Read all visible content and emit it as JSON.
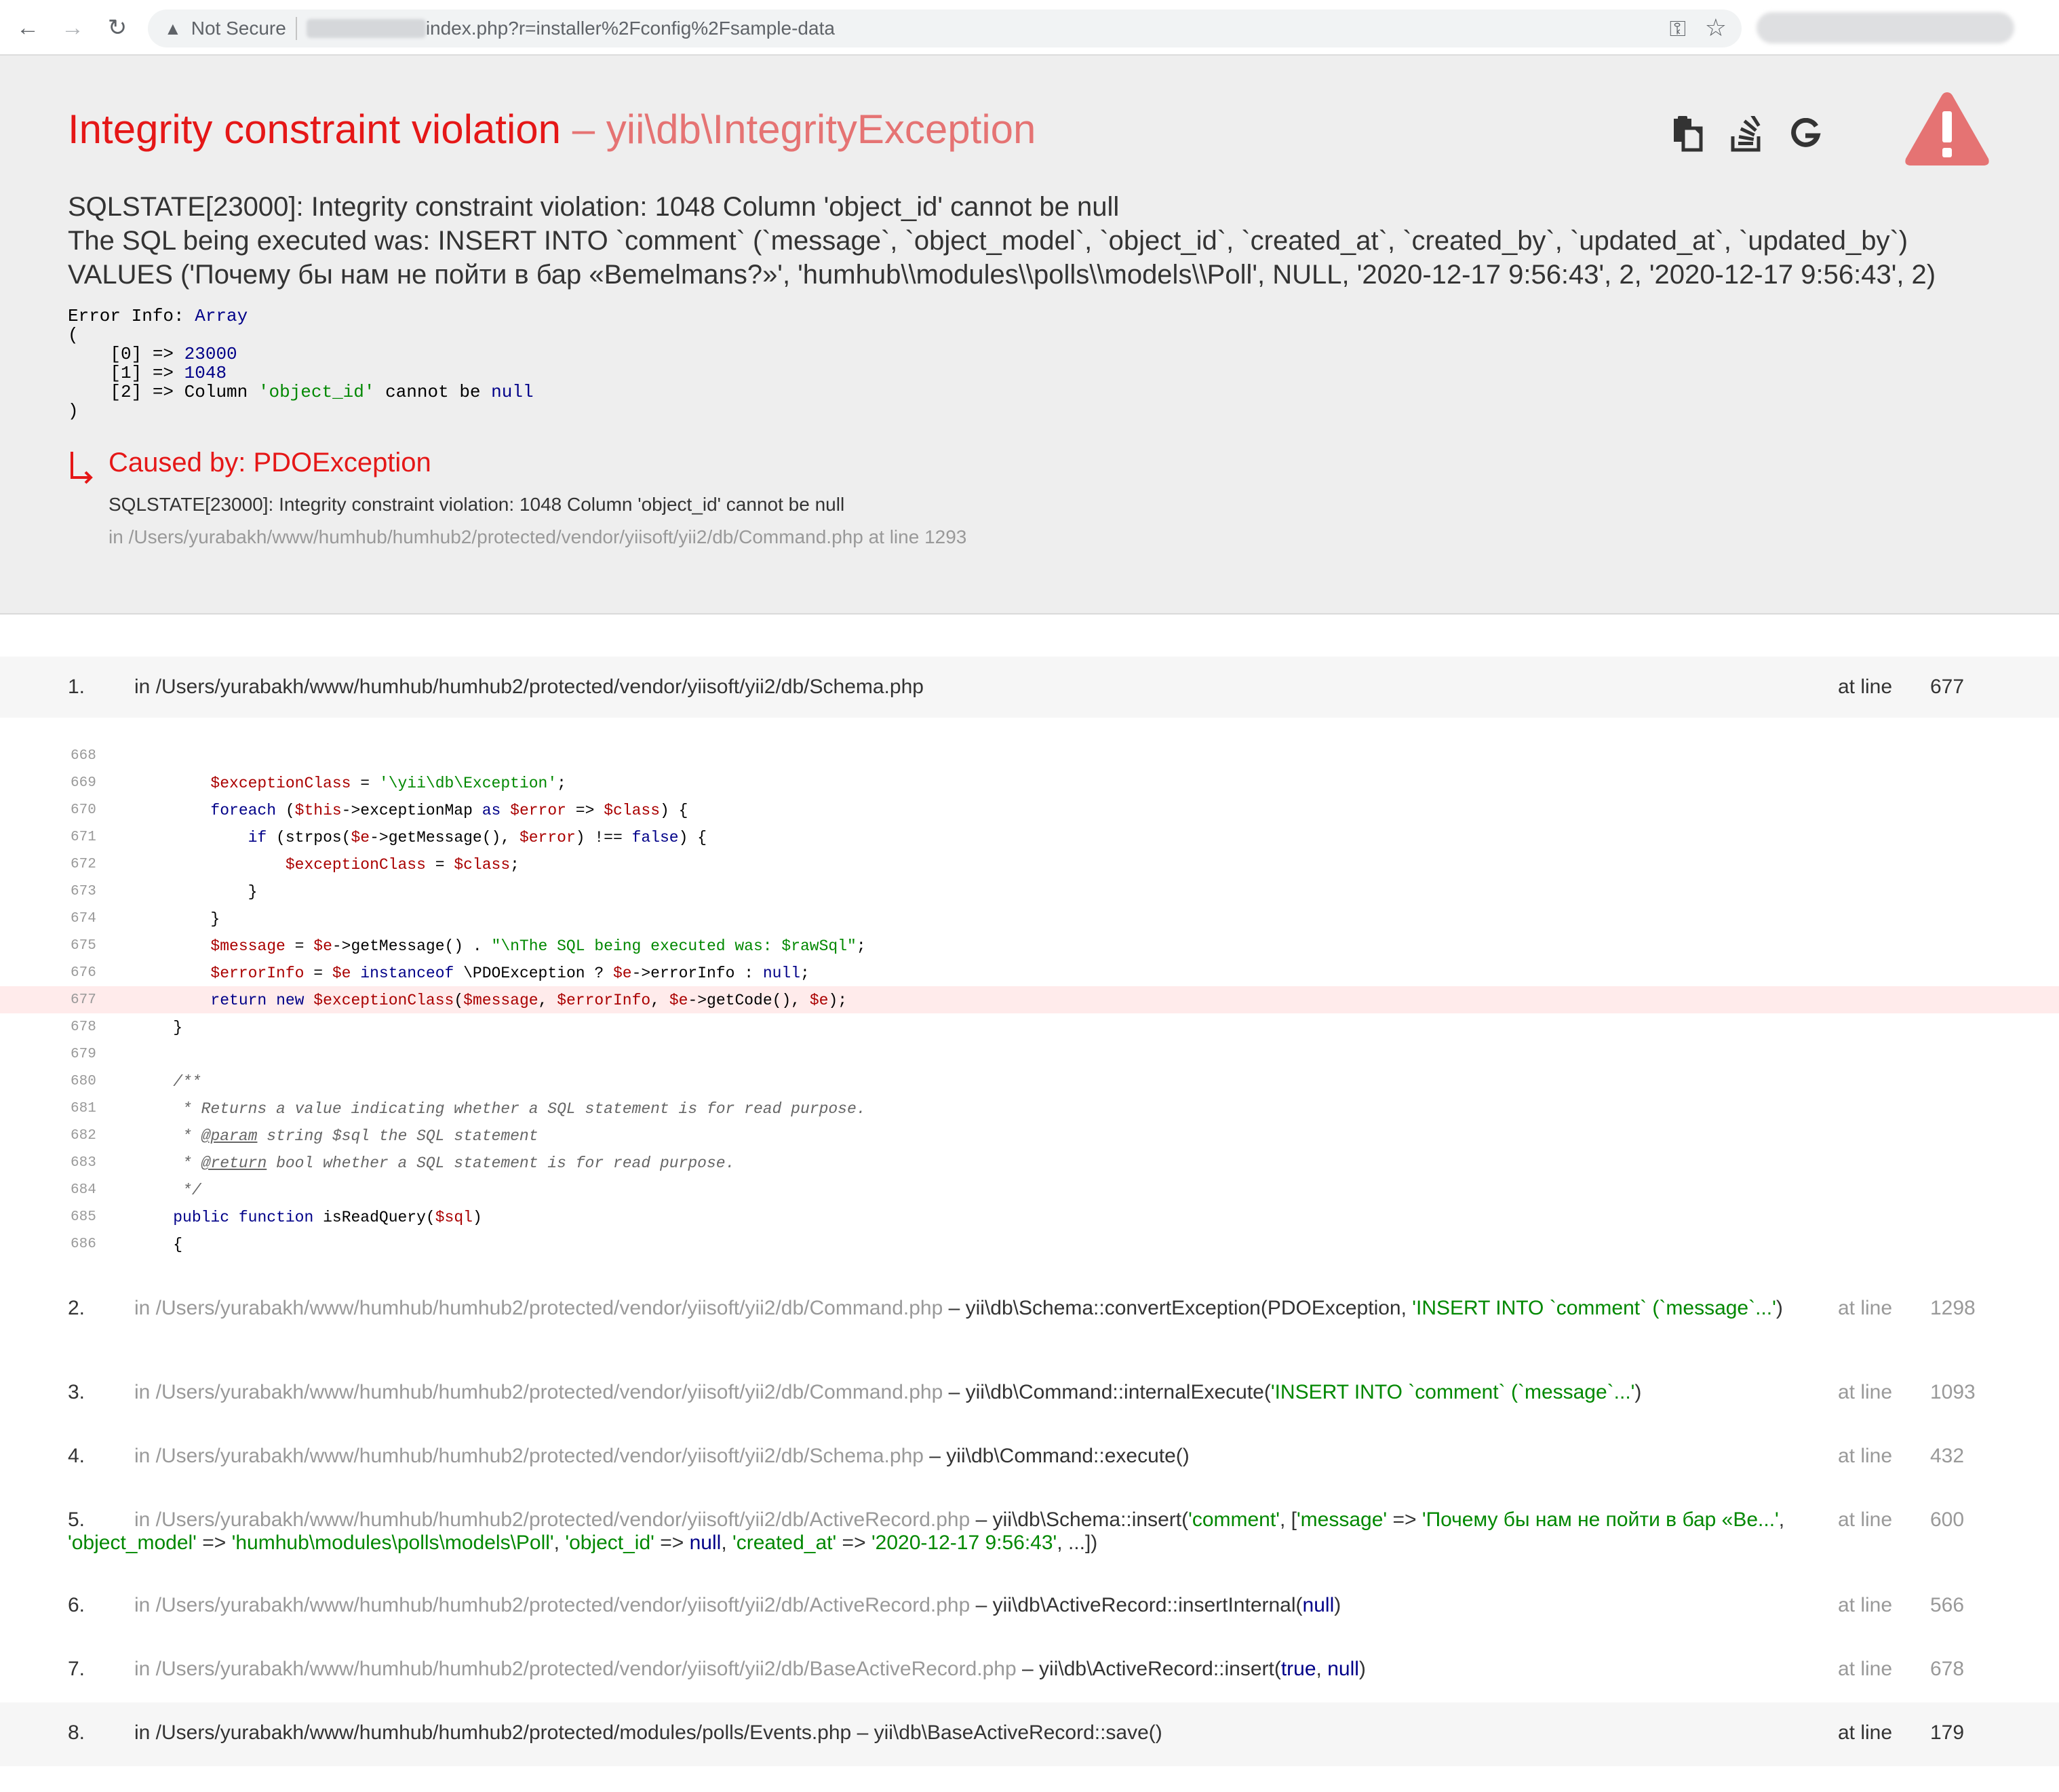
{
  "browser": {
    "security_label": "Not Secure",
    "url_visible": "index.php?r=installer%2Fconfig%2Fsample-data"
  },
  "header": {
    "title_main": "Integrity constraint violation",
    "title_sub": " – yii\\db\\IntegrityException",
    "message_line1": "SQLSTATE[23000]: Integrity constraint violation: 1048 Column 'object_id' cannot be null",
    "message_line2": "The SQL being executed was: INSERT INTO `comment` (`message`, `object_model`, `object_id`, `created_at`, `created_by`, `updated_at`, `updated_by`)",
    "message_line3": "VALUES ('Почему бы нам не пойти в бар «Bemelmans?»', 'humhub\\\\modules\\\\polls\\\\models\\\\Poll', NULL, '2020-12-17 9:56:43', 2, '2020-12-17 9:56:43', 2)",
    "error_info": {
      "label": "Error Info: ",
      "type": "Array",
      "open": "(",
      "rows": [
        {
          "key": "    [0] => ",
          "value": "23000"
        },
        {
          "key": "    [1] => ",
          "value": "1048"
        },
        {
          "key": "    [2] => ",
          "value_pre": "Column ",
          "value_str": "'object_id'",
          "value_mid": " cannot be ",
          "value_kw": "null"
        }
      ],
      "close": ")"
    },
    "caused_by": "Caused by: PDOException",
    "caused_message": "SQLSTATE[23000]: Integrity constraint violation: 1048 Column 'object_id' cannot be null",
    "caused_file": "in /Users/yurabakh/www/humhub/humhub2/protected/vendor/yiisoft/yii2/db/Command.php at line 1293"
  },
  "stack": {
    "at_line_label": "at line",
    "frame1": {
      "num": "1.",
      "file": "in /Users/yurabakh/www/humhub/humhub2/protected/vendor/yiisoft/yii2/db/Schema.php",
      "line": "677"
    },
    "code": [
      {
        "n": "668"
      },
      {
        "n": "669"
      },
      {
        "n": "670"
      },
      {
        "n": "671"
      },
      {
        "n": "672"
      },
      {
        "n": "673"
      },
      {
        "n": "674"
      },
      {
        "n": "675"
      },
      {
        "n": "676"
      },
      {
        "n": "677"
      },
      {
        "n": "678"
      },
      {
        "n": "679"
      },
      {
        "n": "680"
      },
      {
        "n": "681"
      },
      {
        "n": "682"
      },
      {
        "n": "683"
      },
      {
        "n": "684"
      },
      {
        "n": "685"
      },
      {
        "n": "686"
      }
    ],
    "code_text": {
      "l669_var": "$exceptionClass",
      "l669_op": " = ",
      "l669_str": "'\\yii\\db\\Exception'",
      "l669_end": ";",
      "l670_kw": "foreach",
      "l670_a": " (",
      "l670_v1": "$this",
      "l670_b": "->exceptionMap ",
      "l670_kw2": "as",
      "l670_c": " ",
      "l670_v2": "$error",
      "l670_d": " => ",
      "l670_v3": "$class",
      "l670_e": ") {",
      "l671_kw": "if",
      "l671_a": " (strpos(",
      "l671_v1": "$e",
      "l671_b": "->getMessage(), ",
      "l671_v2": "$error",
      "l671_c": ") !== ",
      "l671_kw2": "false",
      "l671_d": ") {",
      "l672_v1": "$exceptionClass",
      "l672_a": " = ",
      "l672_v2": "$class",
      "l672_b": ";",
      "l673": "}",
      "l674": "}",
      "l675_v1": "$message",
      "l675_a": " = ",
      "l675_v2": "$e",
      "l675_b": "->getMessage() . ",
      "l675_str": "\"\\nThe SQL being executed was: $rawSql\"",
      "l675_c": ";",
      "l676_v1": "$errorInfo",
      "l676_a": " = ",
      "l676_v2": "$e",
      "l676_b": " ",
      "l676_kw": "instanceof",
      "l676_c": " \\PDOException ? ",
      "l676_v3": "$e",
      "l676_d": "->errorInfo : ",
      "l676_kw2": "null",
      "l676_e": ";",
      "l677_kw": "return",
      "l677_a": " ",
      "l677_kw2": "new",
      "l677_b": " ",
      "l677_v1": "$exceptionClass",
      "l677_c": "(",
      "l677_v2": "$message",
      "l677_d": ", ",
      "l677_v3": "$errorInfo",
      "l677_e": ", ",
      "l677_v4": "$e",
      "l677_f": "->getCode(), ",
      "l677_v5": "$e",
      "l677_g": ");",
      "l678": "}",
      "l680": "/**",
      "l681": " * Returns a value indicating whether a SQL statement is for read purpose.",
      "l682_a": " * ",
      "l682_tag": "@param",
      "l682_b": " string $sql the SQL statement",
      "l683_a": " * ",
      "l683_tag": "@return",
      "l683_b": " bool whether a SQL statement is for read purpose.",
      "l684": " */",
      "l685_kw": "public",
      "l685_a": " ",
      "l685_kw2": "function",
      "l685_b": " isReadQuery(",
      "l685_v": "$sql",
      "l685_c": ")",
      "l686": "{"
    },
    "frames": [
      {
        "num": "2.",
        "file": "in /Users/yurabakh/www/humhub/humhub2/protected/vendor/yiisoft/yii2/db/Command.php",
        "call_a": " – yii\\db\\Schema::convertException(PDOException, ",
        "call_str": "'INSERT INTO `comment` (`message`...'",
        "call_b": ")",
        "line": "1298"
      },
      {
        "num": "3.",
        "file": "in /Users/yurabakh/www/humhub/humhub2/protected/vendor/yiisoft/yii2/db/Command.php",
        "call_a": " – yii\\db\\Command::internalExecute(",
        "call_str": "'INSERT INTO `comment` (`message`...'",
        "call_b": ")",
        "line": "1093"
      },
      {
        "num": "4.",
        "file": "in /Users/yurabakh/www/humhub/humhub2/protected/vendor/yiisoft/yii2/db/Schema.php",
        "call_a": " – yii\\db\\Command::execute()",
        "line": "432"
      },
      {
        "num": "5.",
        "file": "in /Users/yurabakh/www/humhub/humhub2/protected/vendor/yiisoft/yii2/db/ActiveRecord.php",
        "call_a": " – yii\\db\\Schema::insert(",
        "call_s1": "'comment'",
        "call_b": ", [",
        "call_s2": "'message'",
        "call_c": " => ",
        "call_s3": "'Почему бы нам не пойти в бар «Be...'",
        "call_d": ", ",
        "call_s4": "'object_model'",
        "call_e": " => ",
        "call_s5": "'humhub\\modules\\polls\\models\\Poll'",
        "call_f": ", ",
        "call_s6": "'object_id'",
        "call_g": " => ",
        "call_k1": "null",
        "call_h": ", ",
        "call_s7": "'created_at'",
        "call_i": " => ",
        "call_s8": "'2020-12-17 9:56:43'",
        "call_j": ", ...])",
        "line": "600"
      },
      {
        "num": "6.",
        "file": "in /Users/yurabakh/www/humhub/humhub2/protected/vendor/yiisoft/yii2/db/ActiveRecord.php",
        "call_a": " – yii\\db\\ActiveRecord::insertInternal(",
        "call_k1": "null",
        "call_b": ")",
        "line": "566"
      },
      {
        "num": "7.",
        "file": "in /Users/yurabakh/www/humhub/humhub2/protected/vendor/yiisoft/yii2/db/BaseActiveRecord.php",
        "call_a": " – yii\\db\\ActiveRecord::insert(",
        "call_k1": "true",
        "call_b": ", ",
        "call_k2": "null",
        "call_c": ")",
        "line": "678"
      },
      {
        "num": "8.",
        "file": "in /Users/yurabakh/www/humhub/humhub2/protected/modules/polls/Events.php",
        "call_a": " – yii\\db\\BaseActiveRecord::save()",
        "line": "179"
      }
    ]
  },
  "colors": {
    "title": "#e51717",
    "title_sub": "#e57373",
    "header_bg": "#eeeeee",
    "error_line_bg": "#ffebeb",
    "string": "#008800",
    "keyword": "#000088",
    "variable": "#aa0000"
  },
  "icons": [
    "back-arrow-icon",
    "forward-arrow-icon",
    "reload-icon",
    "warning-triangle-icon",
    "key-icon",
    "bookmark-star-icon",
    "copy-icon",
    "stackoverflow-icon",
    "google-icon",
    "big-warning-icon",
    "caused-by-arrow-icon"
  ]
}
